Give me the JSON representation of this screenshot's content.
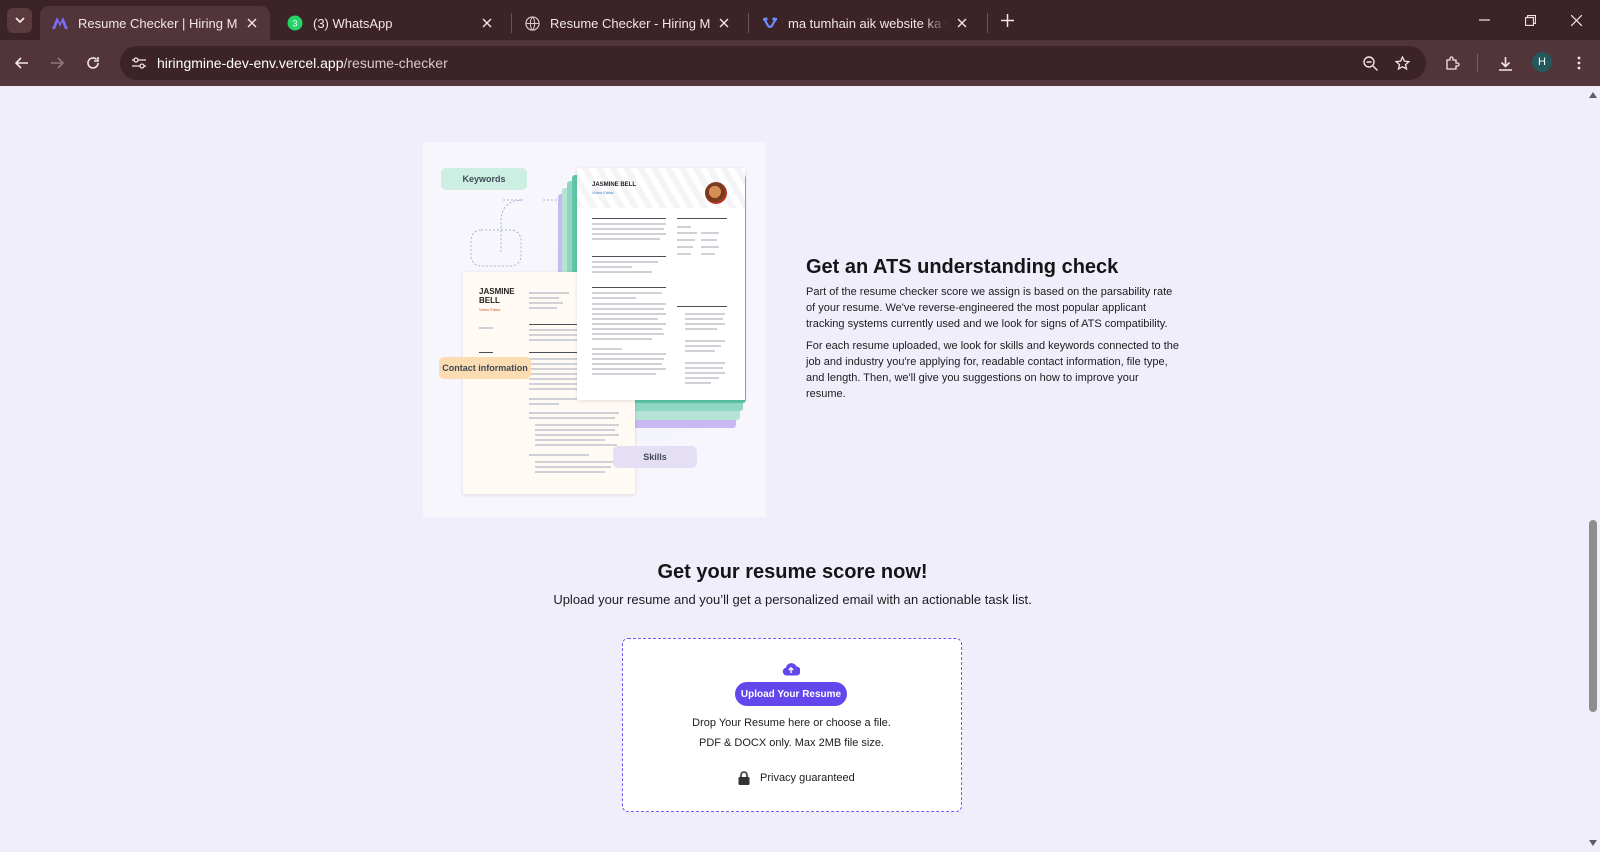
{
  "browser": {
    "tabs": [
      {
        "title": "Resume Checker | Hiring Mine",
        "icon": "hiring-mine-logo",
        "active": true
      },
      {
        "title": "(3) WhatsApp",
        "icon": "whatsapp-icon",
        "badge": "3",
        "active": false
      },
      {
        "title": "Resume Checker - Hiring Mine",
        "icon": "globe-icon",
        "active": false
      },
      {
        "title": "ma tumhain aik website ka scre",
        "icon": "ai-assistant-icon",
        "active": false
      }
    ],
    "url_host": "hiringmine-dev-env.vercel.app",
    "url_path": "/resume-checker",
    "profile_initial": "H"
  },
  "illustration": {
    "tags": {
      "keywords": "Keywords",
      "contact": "Contact information",
      "skills": "Skills"
    },
    "resume_name_left": "JASMINE\nBELL",
    "resume_role_left": "Video Editor",
    "resume_name_right": "JASMINE BELL",
    "resume_role_right": "Video Editor"
  },
  "ats": {
    "title": "Get an ATS understanding check",
    "paragraph1": "Part of the resume checker score we assign is based on the parsability rate of your resume. We've reverse-engineered the most popular applicant tracking systems currently used and we look for signs of ATS compatibility.",
    "paragraph2": "For each resume uploaded, we look for skills and keywords connected to the job and industry you're applying for, readable contact information, file type, and length. Then, we'll give you suggestions on how to improve your resume."
  },
  "score": {
    "title": "Get your resume score now!",
    "subtitle": "Upload your resume and you’ll get a personalized email with an actionable task list."
  },
  "upload": {
    "button_label": "Upload Your Resume",
    "drop_text": "Drop Your Resume here or choose a file.",
    "file_text": "PDF & DOCX only. Max 2MB file size.",
    "privacy_text": "Privacy guaranteed"
  },
  "colors": {
    "accent": "#6346ec",
    "chrome_dark": "#3b2327",
    "chrome_toolbar": "#52353a",
    "page_bg": "#f1eefc"
  }
}
